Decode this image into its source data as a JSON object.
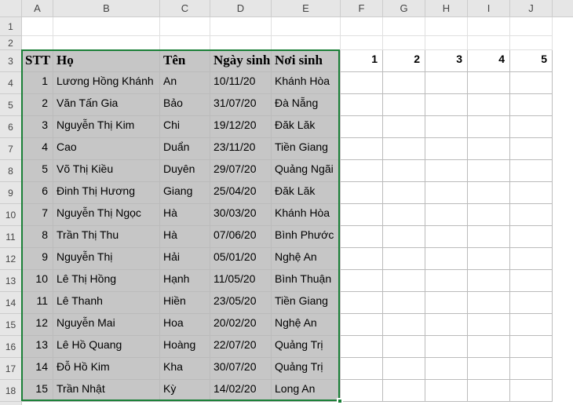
{
  "columns": [
    "A",
    "B",
    "C",
    "D",
    "E",
    "F",
    "G",
    "H",
    "I",
    "J"
  ],
  "row_start": 1,
  "row_end": 18,
  "headers": {
    "stt": "STT",
    "ho": "Họ",
    "ten": "Tên",
    "ngaysinh": "Ngày sinh",
    "noisinh": "Nơi sinh",
    "c1": "1",
    "c2": "2",
    "c3": "3",
    "c4": "4",
    "c5": "5"
  },
  "rows": [
    {
      "stt": "1",
      "ho": "Lương Hồng Khánh",
      "ten": "An",
      "ngay": "10/11/20",
      "noi": "Khánh Hòa"
    },
    {
      "stt": "2",
      "ho": "Văn Tấn Gia",
      "ten": "Bảo",
      "ngay": "31/07/20",
      "noi": "Đà Nẵng"
    },
    {
      "stt": "3",
      "ho": "Nguyễn Thị Kim",
      "ten": "Chi",
      "ngay": "19/12/20",
      "noi": "Đăk Lăk"
    },
    {
      "stt": "4",
      "ho": "Cao",
      "ten": "Duẩn",
      "ngay": "23/11/20",
      "noi": "Tiền Giang"
    },
    {
      "stt": "5",
      "ho": "Võ Thị Kiều",
      "ten": "Duyên",
      "ngay": "29/07/20",
      "noi": "Quảng Ngãi"
    },
    {
      "stt": "6",
      "ho": "Đinh Thị Hương",
      "ten": "Giang",
      "ngay": "25/04/20",
      "noi": "Đăk Lăk"
    },
    {
      "stt": "7",
      "ho": "Nguyễn Thị Ngọc",
      "ten": "Hà",
      "ngay": "30/03/20",
      "noi": "Khánh Hòa"
    },
    {
      "stt": "8",
      "ho": "Trần Thị Thu",
      "ten": "Hà",
      "ngay": "07/06/20",
      "noi": "Bình Phước"
    },
    {
      "stt": "9",
      "ho": "Nguyễn Thị",
      "ten": "Hải",
      "ngay": "05/01/20",
      "noi": "Nghệ An"
    },
    {
      "stt": "10",
      "ho": "Lê Thị Hồng",
      "ten": "Hạnh",
      "ngay": "11/05/20",
      "noi": "Bình Thuận"
    },
    {
      "stt": "11",
      "ho": "Lê Thanh",
      "ten": "Hiền",
      "ngay": "23/05/20",
      "noi": "Tiền Giang"
    },
    {
      "stt": "12",
      "ho": "Nguyễn Mai",
      "ten": "Hoa",
      "ngay": "20/02/20",
      "noi": "Nghệ An"
    },
    {
      "stt": "13",
      "ho": "Lê Hồ Quang",
      "ten": "Hoàng",
      "ngay": "22/07/20",
      "noi": "Quảng Trị"
    },
    {
      "stt": "14",
      "ho": "Đỗ Hồ Kim",
      "ten": "Kha",
      "ngay": "30/07/20",
      "noi": "Quảng Trị"
    },
    {
      "stt": "15",
      "ho": "Trần Nhật",
      "ten": "Kỳ",
      "ngay": "14/02/20",
      "noi": "Long An"
    }
  ],
  "selection": {
    "top_row": 3,
    "bottom_row": 18,
    "left_col": "A",
    "right_col": "E"
  },
  "chart_data": {
    "type": "table",
    "columns": [
      "STT",
      "Họ",
      "Tên",
      "Ngày sinh",
      "Nơi sinh",
      "1",
      "2",
      "3",
      "4",
      "5"
    ],
    "data": [
      [
        1,
        "Lương Hồng Khánh",
        "An",
        "10/11/20",
        "Khánh Hòa",
        "",
        "",
        "",
        "",
        ""
      ],
      [
        2,
        "Văn Tấn Gia",
        "Bảo",
        "31/07/20",
        "Đà Nẵng",
        "",
        "",
        "",
        "",
        ""
      ],
      [
        3,
        "Nguyễn Thị Kim",
        "Chi",
        "19/12/20",
        "Đăk Lăk",
        "",
        "",
        "",
        "",
        ""
      ],
      [
        4,
        "Cao",
        "Duẩn",
        "23/11/20",
        "Tiền Giang",
        "",
        "",
        "",
        "",
        ""
      ],
      [
        5,
        "Võ Thị Kiều",
        "Duyên",
        "29/07/20",
        "Quảng Ngãi",
        "",
        "",
        "",
        "",
        ""
      ],
      [
        6,
        "Đinh Thị Hương",
        "Giang",
        "25/04/20",
        "Đăk Lăk",
        "",
        "",
        "",
        "",
        ""
      ],
      [
        7,
        "Nguyễn Thị Ngọc",
        "Hà",
        "30/03/20",
        "Khánh Hòa",
        "",
        "",
        "",
        "",
        ""
      ],
      [
        8,
        "Trần Thị Thu",
        "Hà",
        "07/06/20",
        "Bình Phước",
        "",
        "",
        "",
        "",
        ""
      ],
      [
        9,
        "Nguyễn Thị",
        "Hải",
        "05/01/20",
        "Nghệ An",
        "",
        "",
        "",
        "",
        ""
      ],
      [
        10,
        "Lê Thị Hồng",
        "Hạnh",
        "11/05/20",
        "Bình Thuận",
        "",
        "",
        "",
        "",
        ""
      ],
      [
        11,
        "Lê Thanh",
        "Hiền",
        "23/05/20",
        "Tiền Giang",
        "",
        "",
        "",
        "",
        ""
      ],
      [
        12,
        "Nguyễn Mai",
        "Hoa",
        "20/02/20",
        "Nghệ An",
        "",
        "",
        "",
        "",
        ""
      ],
      [
        13,
        "Lê Hồ Quang",
        "Hoàng",
        "22/07/20",
        "Quảng Trị",
        "",
        "",
        "",
        "",
        ""
      ],
      [
        14,
        "Đỗ Hồ Kim",
        "Kha",
        "30/07/20",
        "Quảng Trị",
        "",
        "",
        "",
        "",
        ""
      ],
      [
        15,
        "Trần Nhật",
        "Kỳ",
        "14/02/20",
        "Long An",
        "",
        "",
        "",
        "",
        ""
      ]
    ]
  }
}
